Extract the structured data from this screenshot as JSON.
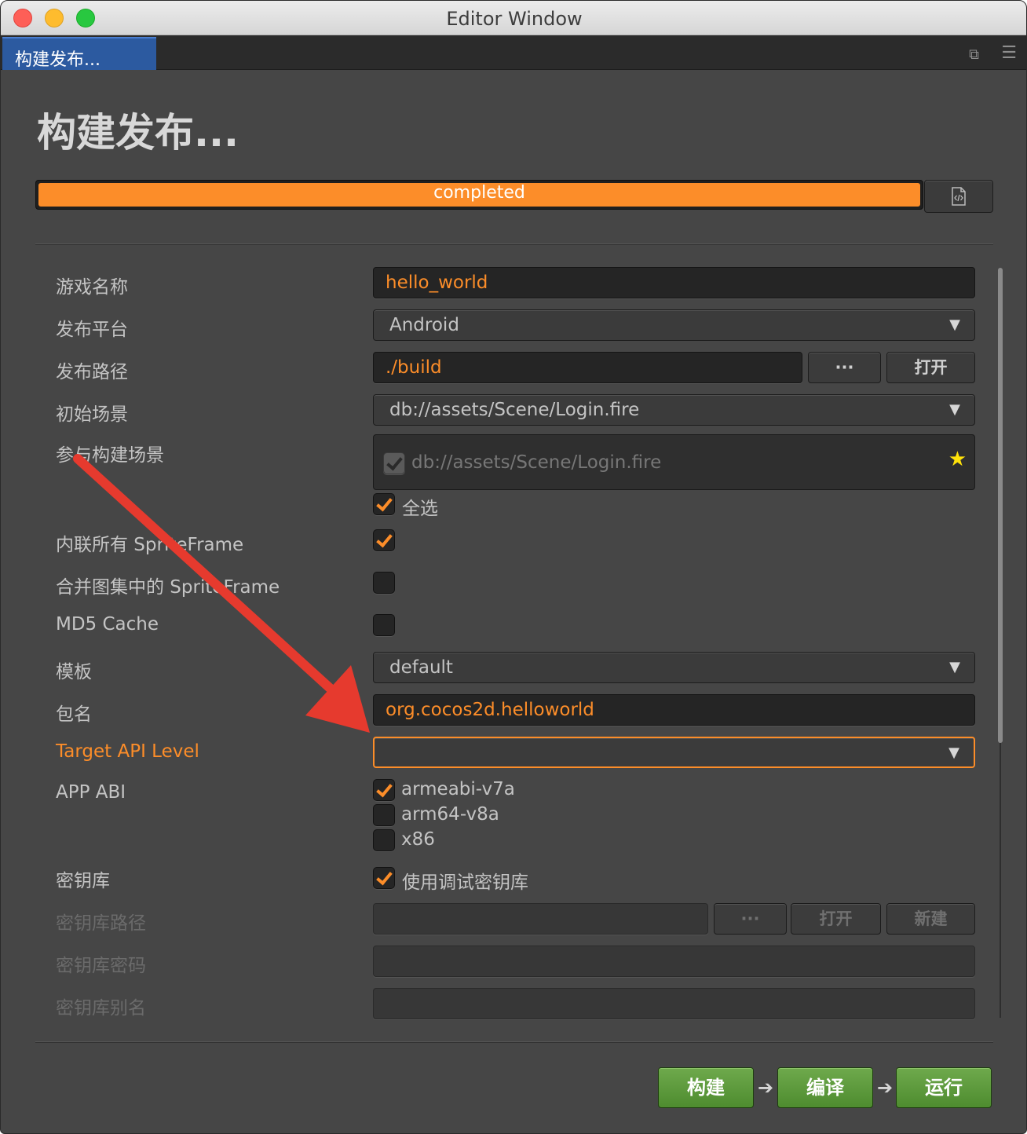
{
  "window": {
    "title": "Editor Window"
  },
  "tab": {
    "label": "构建发布..."
  },
  "page": {
    "title": "构建发布..."
  },
  "progress": {
    "text": "completed",
    "value": 1.0
  },
  "fields": {
    "game_name": {
      "label": "游戏名称",
      "value": "hello_world"
    },
    "platform": {
      "label": "发布平台",
      "value": "Android"
    },
    "build_path": {
      "label": "发布路径",
      "value": "./build",
      "browse": "···",
      "open": "打开"
    },
    "start_scene": {
      "label": "初始场景",
      "value": "db://assets/Scene/Login.fire"
    },
    "included_scenes": {
      "label": "参与构建场景",
      "scene": "db://assets/Scene/Login.fire",
      "select_all": "全选"
    },
    "inline_spriteframe": {
      "label": "内联所有 SpriteFrame",
      "checked": true
    },
    "merge_spriteframe": {
      "label": "合并图集中的 SpriteFrame",
      "checked": false
    },
    "md5_cache": {
      "label": "MD5 Cache",
      "checked": false
    },
    "template": {
      "label": "模板",
      "value": "default"
    },
    "package_name": {
      "label": "包名",
      "value": "org.cocos2d.helloworld"
    },
    "target_api": {
      "label": "Target API Level",
      "value": ""
    },
    "app_abi": {
      "label": "APP ABI",
      "options": [
        {
          "label": "armeabi-v7a",
          "checked": true
        },
        {
          "label": "arm64-v8a",
          "checked": false
        },
        {
          "label": "x86",
          "checked": false
        }
      ]
    },
    "keystore": {
      "label": "密钥库",
      "debug": "使用调试密钥库",
      "checked": true
    },
    "keystore_path": {
      "label": "密钥库路径",
      "value": "",
      "browse": "···",
      "open": "打开",
      "new": "新建"
    },
    "keystore_password": {
      "label": "密钥库密码",
      "value": ""
    },
    "keystore_alias": {
      "label": "密钥库别名",
      "value": ""
    }
  },
  "actions": {
    "build": "构建",
    "compile": "编译",
    "run": "运行"
  },
  "colors": {
    "accent": "#fc8d29",
    "action_green": "#5e9b3d",
    "annotation_red": "#e63a2e"
  }
}
